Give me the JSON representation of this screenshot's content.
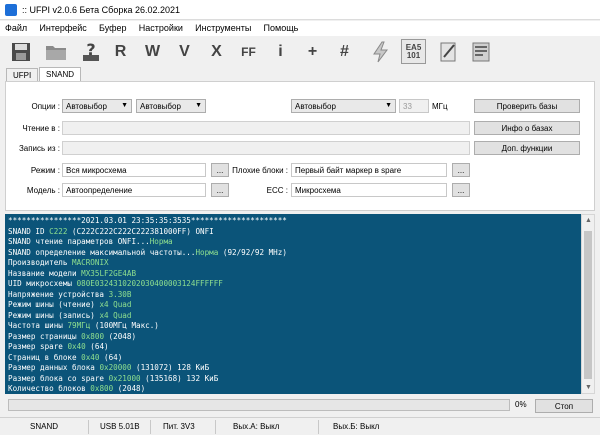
{
  "window": {
    "title": ":: UFPI v2.0.6 Бета Сборка 26.02.2021"
  },
  "menu": [
    "Файл",
    "Интерфейс",
    "Буфер",
    "Настройки",
    "Инструменты",
    "Помощь"
  ],
  "toolbar": {
    "r_label": "R",
    "w_label": "W",
    "v_label": "V",
    "x_label": "X",
    "ff_label": "FF",
    "i_label": "i",
    "plus_label": "+",
    "hash_label": "#",
    "ea5_label": "EA5\n101"
  },
  "tabs": [
    {
      "label": "UFPI"
    },
    {
      "label": "SNAND"
    }
  ],
  "form": {
    "options_label": "Опции :",
    "option1": "Автовыбор",
    "option2": "Автовыбор",
    "option3": "Автовыбор",
    "frequency": "33",
    "freq_unit": "МГц",
    "read_label": "Чтение в :",
    "write_label": "Запись из :",
    "mode_label": "Режим :",
    "mode_value": "Вся микросхема",
    "badblocks_label": "Плохие блоки :",
    "badblocks_value": "Первый байт маркер в spare",
    "model_label": "Модель :",
    "model_value": "Автоопределение",
    "ecc_label": "ECC :",
    "ecc_value": "Микросхема",
    "browse": "..."
  },
  "buttons": {
    "check_db": "Проверить базы",
    "db_info": "Инфо о базах",
    "extra": "Доп. функции",
    "stop": "Стоп"
  },
  "log": [
    [
      {
        "t": "****************2021.03.01 23:35:35:3535*********************"
      }
    ],
    [
      {
        "t": "SNAND ID "
      },
      {
        "t": "C222",
        "c": "hl"
      },
      {
        "t": " (C222C222C222C222381000FF) ONFI"
      }
    ],
    [
      {
        "t": "SNAND чтение параметров ONFI..."
      },
      {
        "t": "Норма",
        "c": "hl"
      }
    ],
    [
      {
        "t": "SNAND определение максимальной частоты..."
      },
      {
        "t": "Норма",
        "c": "hl"
      },
      {
        "t": " (92/92/92 MHz)"
      }
    ],
    [
      {
        "t": "Производитель "
      },
      {
        "t": "MACRONIX",
        "c": "hl"
      }
    ],
    [
      {
        "t": "Название модели "
      },
      {
        "t": "MX35LF2GE4AB",
        "c": "hl"
      }
    ],
    [
      {
        "t": "UID микросхемы "
      },
      {
        "t": "080E0324310202030400003124FFFFFF",
        "c": "hl"
      }
    ],
    [
      {
        "t": "Напряжение устройства "
      },
      {
        "t": "3.30В",
        "c": "hl"
      }
    ],
    [
      {
        "t": "Режим шины (чтение) "
      },
      {
        "t": "x4 Quad",
        "c": "hl"
      }
    ],
    [
      {
        "t": "Режим шины (запись) "
      },
      {
        "t": "x4 Quad",
        "c": "hl"
      }
    ],
    [
      {
        "t": "Частота шины "
      },
      {
        "t": "79МГц",
        "c": "hl"
      },
      {
        "t": " (100МГц Макс.)"
      }
    ],
    [
      {
        "t": "Размер страницы "
      },
      {
        "t": "0x800",
        "c": "hl"
      },
      {
        "t": " (2048)"
      }
    ],
    [
      {
        "t": "Размер spare "
      },
      {
        "t": "0x40",
        "c": "hl"
      },
      {
        "t": " (64)"
      }
    ],
    [
      {
        "t": "Страниц в блоке "
      },
      {
        "t": "0x40",
        "c": "hl"
      },
      {
        "t": " (64)"
      }
    ],
    [
      {
        "t": "Размер данных блока "
      },
      {
        "t": "0x20000",
        "c": "hl"
      },
      {
        "t": " (131072) 128 КиБ"
      }
    ],
    [
      {
        "t": "Размер блока со spare "
      },
      {
        "t": "0x21000",
        "c": "hl"
      },
      {
        "t": " (135168) 132 КиБ"
      }
    ],
    [
      {
        "t": "Количество блоков "
      },
      {
        "t": "0x800",
        "c": "hl"
      },
      {
        "t": " (2048)"
      }
    ]
  ],
  "progress": {
    "value": 0,
    "label": "0%"
  },
  "status": {
    "mode": "SNAND",
    "usb": "USB 5.01B",
    "power": "Пит. 3V3",
    "out_a": "Вых.А: Выкл",
    "out_b": "Вых.Б: Выкл"
  }
}
